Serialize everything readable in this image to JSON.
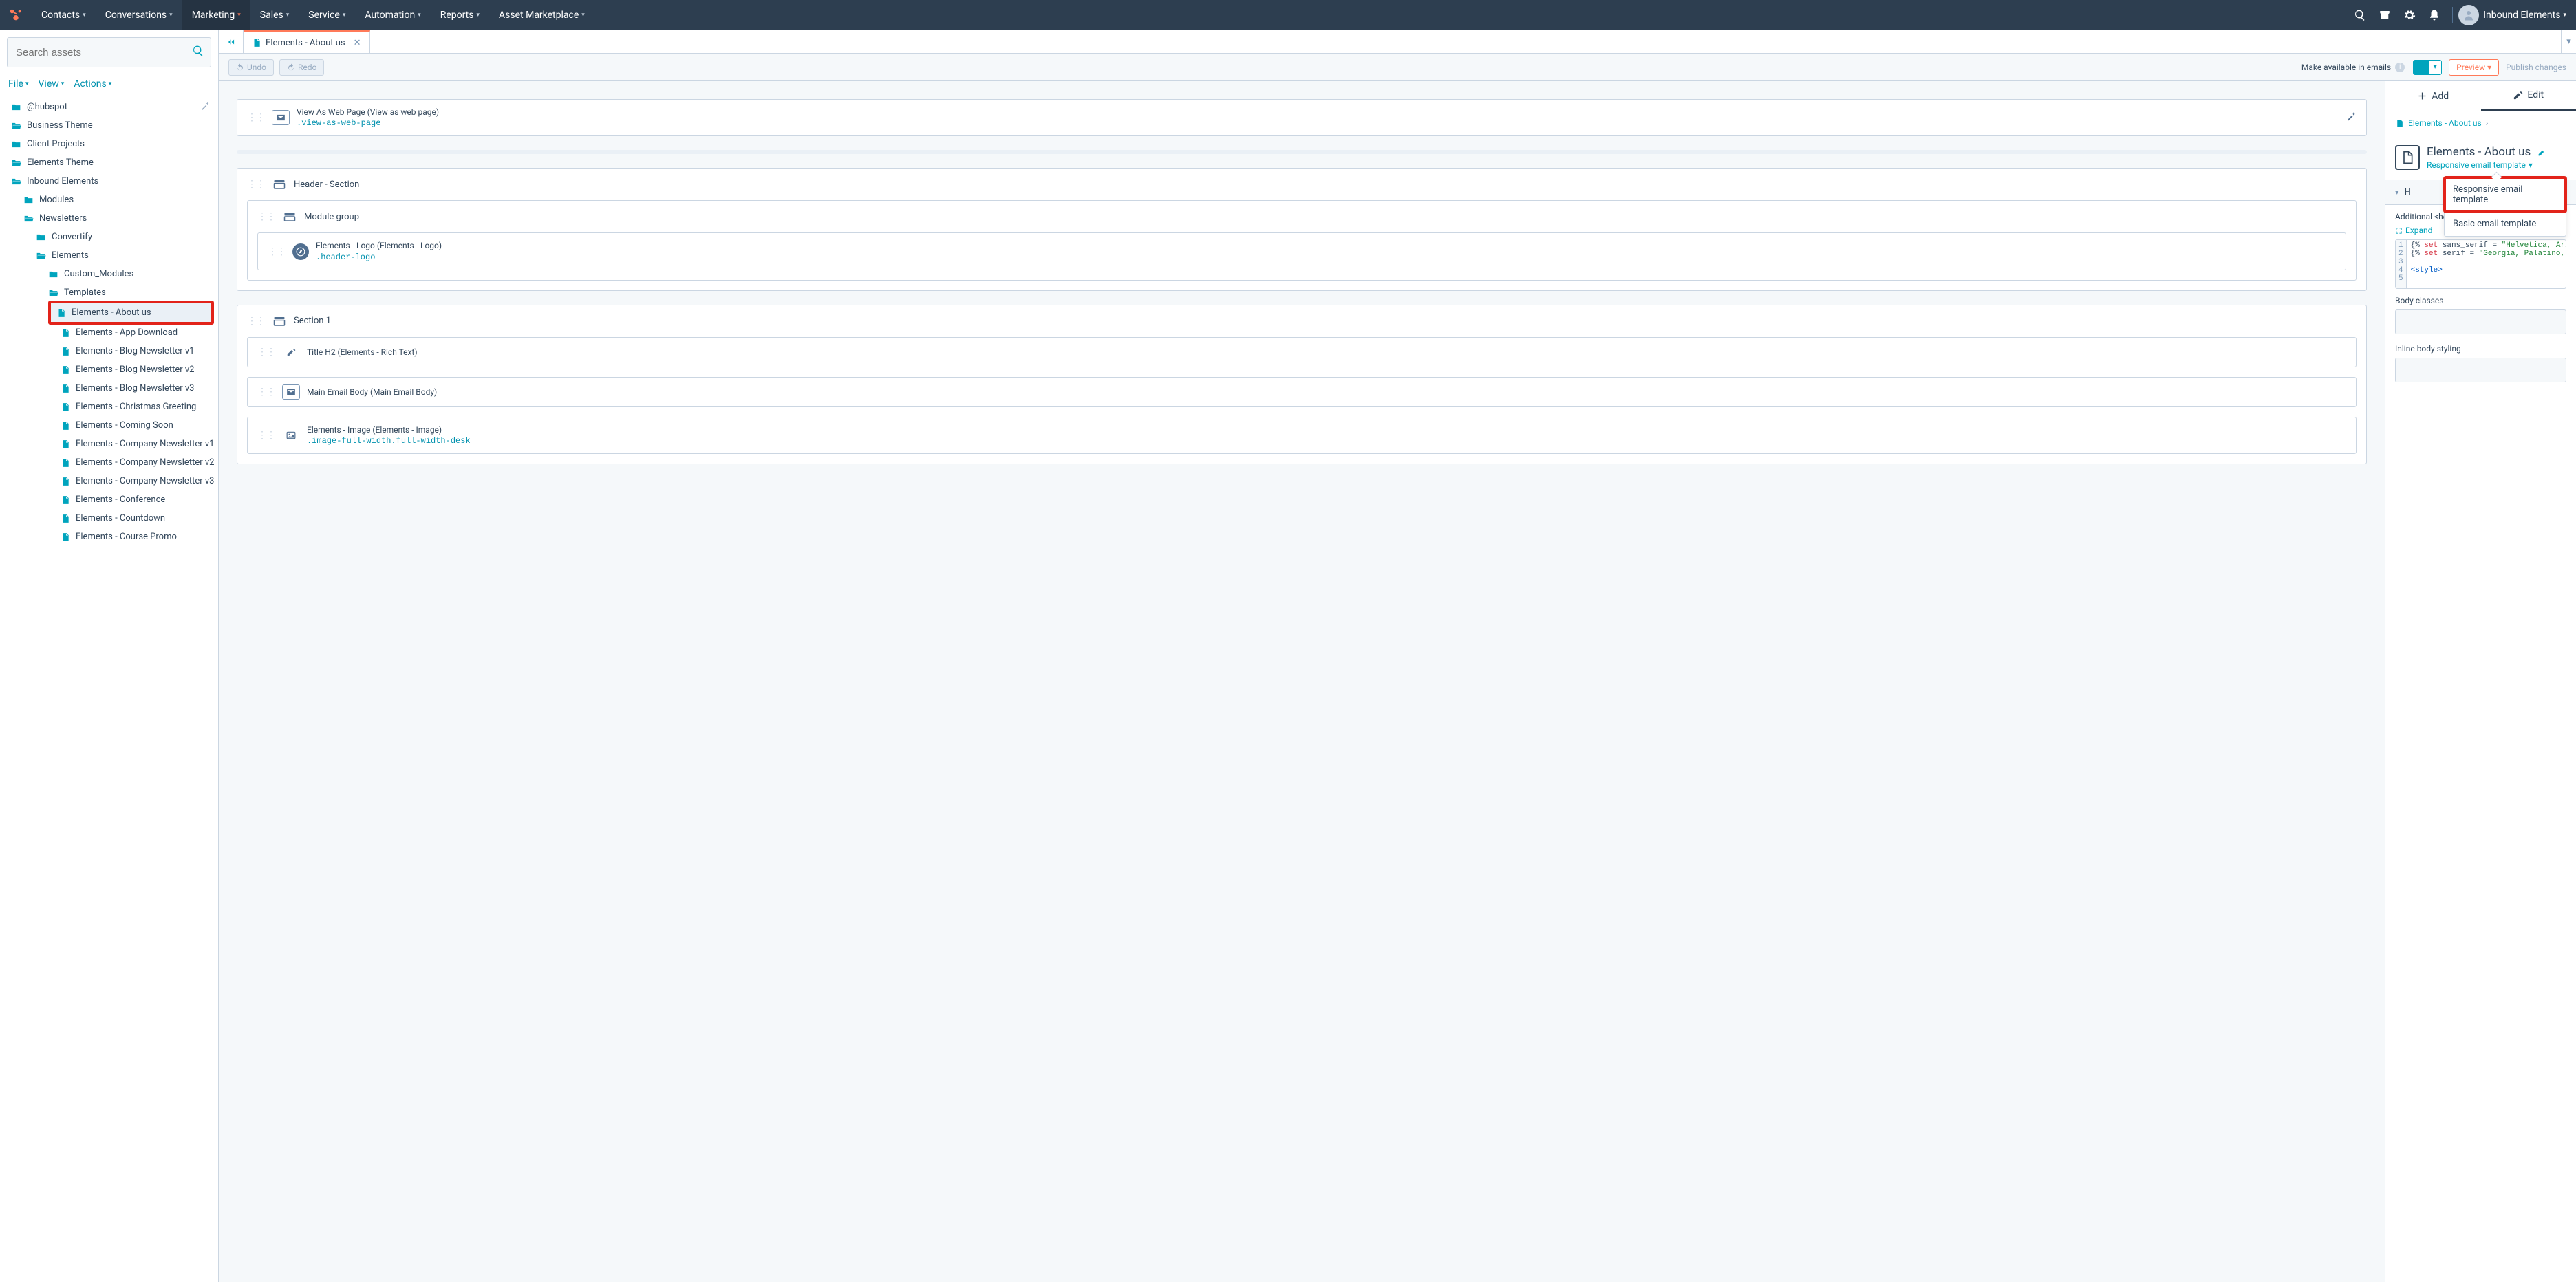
{
  "nav": {
    "items": [
      "Contacts",
      "Conversations",
      "Marketing",
      "Sales",
      "Service",
      "Automation",
      "Reports",
      "Asset Marketplace"
    ],
    "active_index": 2,
    "account": "Inbound Elements"
  },
  "sidebar": {
    "search_placeholder": "Search assets",
    "menus": [
      "File",
      "View",
      "Actions"
    ],
    "tree": [
      {
        "label": "@hubspot",
        "type": "folder",
        "depth": 0
      },
      {
        "label": "Business Theme",
        "type": "folder-open",
        "depth": 0
      },
      {
        "label": "Client Projects",
        "type": "folder",
        "depth": 0
      },
      {
        "label": "Elements Theme",
        "type": "folder-open",
        "depth": 0
      },
      {
        "label": "Inbound Elements",
        "type": "folder-open",
        "depth": 0
      },
      {
        "label": "Modules",
        "type": "folder",
        "depth": 1
      },
      {
        "label": "Newsletters",
        "type": "folder-open",
        "depth": 1
      },
      {
        "label": "Convertify",
        "type": "folder",
        "depth": 2
      },
      {
        "label": "Elements",
        "type": "folder-open",
        "depth": 2
      },
      {
        "label": "Custom_Modules",
        "type": "folder",
        "depth": 3
      },
      {
        "label": "Templates",
        "type": "folder-open",
        "depth": 3
      },
      {
        "label": "Elements - About us",
        "type": "file",
        "depth": 4,
        "selected": true,
        "boxed": true
      },
      {
        "label": "Elements - App Download",
        "type": "file",
        "depth": 4
      },
      {
        "label": "Elements - Blog Newsletter v1",
        "type": "file",
        "depth": 4
      },
      {
        "label": "Elements - Blog Newsletter v2",
        "type": "file",
        "depth": 4
      },
      {
        "label": "Elements - Blog Newsletter v3",
        "type": "file",
        "depth": 4
      },
      {
        "label": "Elements - Christmas Greeting",
        "type": "file",
        "depth": 4
      },
      {
        "label": "Elements - Coming Soon",
        "type": "file",
        "depth": 4
      },
      {
        "label": "Elements - Company Newsletter v1",
        "type": "file",
        "depth": 4
      },
      {
        "label": "Elements - Company Newsletter v2",
        "type": "file",
        "depth": 4
      },
      {
        "label": "Elements - Company Newsletter v3",
        "type": "file",
        "depth": 4
      },
      {
        "label": "Elements - Conference",
        "type": "file",
        "depth": 4
      },
      {
        "label": "Elements - Countdown",
        "type": "file",
        "depth": 4
      },
      {
        "label": "Elements - Course Promo",
        "type": "file",
        "depth": 4
      }
    ]
  },
  "tab": {
    "title": "Elements - About us"
  },
  "toolbar": {
    "undo": "Undo",
    "redo": "Redo",
    "emails_label": "Make available in emails",
    "preview": "Preview",
    "publish": "Publish changes"
  },
  "canvas": {
    "webpage": {
      "line1": "View As Web Page (View as web page)",
      "line2": ".view-as-web-page"
    },
    "header_section": "Header - Section",
    "module_group": "Module group",
    "logo": {
      "line1": "Elements - Logo (Elements - Logo)",
      "line2": ".header-logo"
    },
    "section1": "Section 1",
    "title_h2": "Title H2 (Elements - Rich Text)",
    "main_body": "Main Email Body (Main Email Body)",
    "image": {
      "line1": "Elements - Image (Elements - Image)",
      "line2": ".image-full-width.full-width-desk"
    }
  },
  "right": {
    "add": "Add",
    "edit": "Edit",
    "crumb": "Elements - About us",
    "title": "Elements - About us",
    "subtitle": "Responsive email template",
    "popover": [
      "Responsive email template",
      "Basic email template"
    ],
    "section_h": "H",
    "additional_label": "Additional <head> markup",
    "expand": "Expand",
    "code": [
      {
        "n": 1,
        "parts": [
          {
            "t": "{% ",
            "c": ""
          },
          {
            "t": "set",
            "c": "kw"
          },
          {
            "t": " sans_serif = ",
            "c": ""
          },
          {
            "t": "\"Helvetica, Ari",
            "c": "str"
          }
        ]
      },
      {
        "n": 2,
        "parts": [
          {
            "t": "{% ",
            "c": ""
          },
          {
            "t": "set",
            "c": "kw"
          },
          {
            "t": " serif = ",
            "c": ""
          },
          {
            "t": "\"Georgia, Palatino,",
            "c": "str"
          }
        ]
      },
      {
        "n": 3,
        "parts": []
      },
      {
        "n": 4,
        "parts": [
          {
            "t": "<style>",
            "c": "tag"
          }
        ]
      }
    ],
    "body_classes": "Body classes",
    "inline_styling": "Inline body styling"
  }
}
